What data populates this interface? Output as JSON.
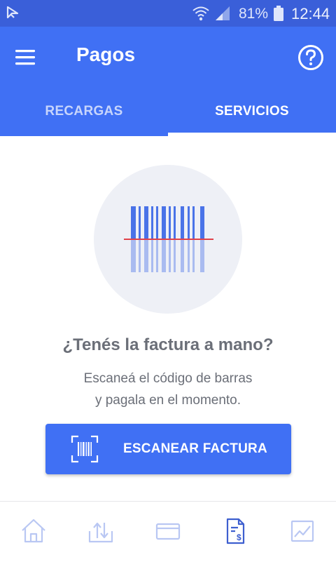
{
  "status_bar": {
    "battery_percent": "81%",
    "time": "12:44",
    "icons": [
      "app-notification-icon",
      "wifi-icon",
      "signal-icon",
      "battery-icon"
    ]
  },
  "app_bar": {
    "title": "Pagos",
    "icons": [
      "menu-icon",
      "help-icon"
    ]
  },
  "tabs": [
    {
      "label": "RECARGAS",
      "selected": false
    },
    {
      "label": "SERVICIOS",
      "selected": true
    }
  ],
  "main": {
    "illustration": "barcode-scan-illustration",
    "question": "¿Tenés la factura a mano?",
    "subtitle_line1": "Escaneá el código de barras",
    "subtitle_line2": "y pagala en el momento.",
    "scan_button_label": "ESCANEAR FACTURA",
    "scan_button_icon": "barcode-scan-icon"
  },
  "bottom_nav": {
    "items": [
      {
        "icon": "home-icon",
        "selected": false
      },
      {
        "icon": "transfer-icon",
        "selected": false
      },
      {
        "icon": "card-icon",
        "selected": false
      },
      {
        "icon": "bill-payment-icon",
        "selected": true
      },
      {
        "icon": "chart-icon",
        "selected": false
      }
    ]
  },
  "colors": {
    "primary": "#4070f4",
    "status_bar": "#3a5fd9",
    "text_gray": "#6b6f78",
    "nav_inactive": "#b9c7f3",
    "illustration_bg": "#eef0f6",
    "scan_line": "#e0424a"
  }
}
